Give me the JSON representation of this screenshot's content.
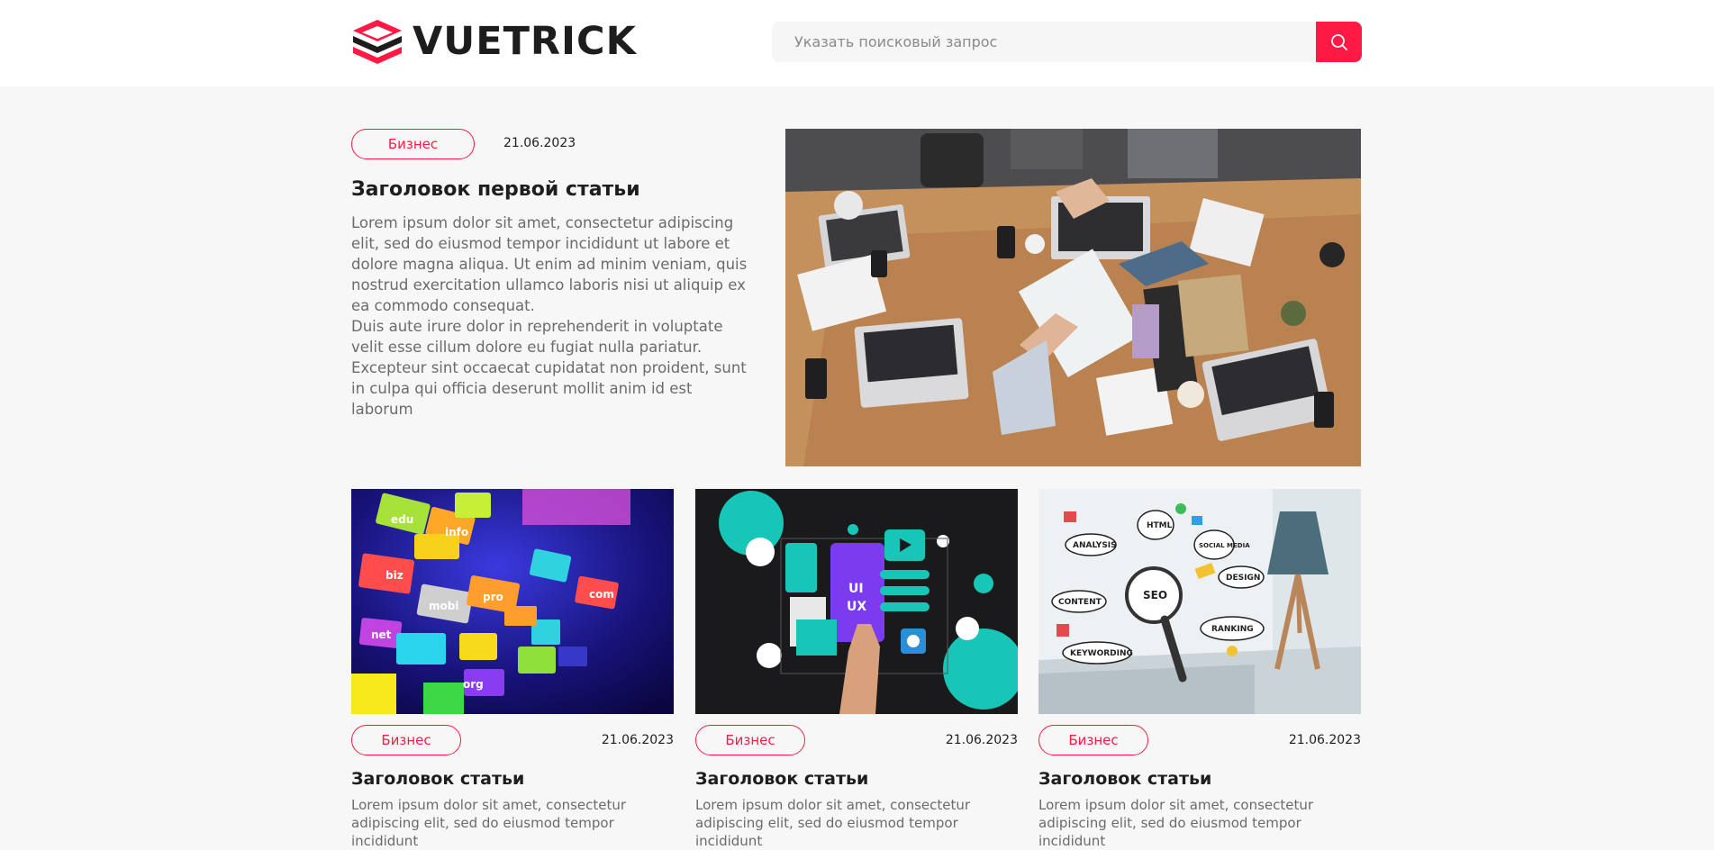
{
  "brand": {
    "name": "VUETRICK",
    "colors": {
      "accent": "#ff1945",
      "dark": "#1d1d1d"
    }
  },
  "search": {
    "placeholder": "Указать поисковый запрос",
    "value": "",
    "icon": "search-icon"
  },
  "featured": {
    "tag": "Бизнес",
    "date": "21.06.2023",
    "title": "Заголовок первой статьи",
    "body_p1": "Lorem ipsum dolor sit amet, consectetur adipiscing elit, sed do eiusmod tempor incididunt ut labore et dolore magna aliqua. Ut enim ad minim veniam, quis nostrud exercitation ullamco laboris nisi ut aliquip ex ea commodo consequat.",
    "body_p2": "Duis aute irure dolor in reprehenderit in voluptate velit esse cillum dolore eu fugiat nulla pariatur. Excepteur sint occaecat cupidatat non proident, sunt in culpa qui officia deserunt mollit anim id est laborum"
  },
  "cards": [
    {
      "tag": "Бизнес",
      "date": "21.06.2023",
      "title": "Заголовок статьи",
      "excerpt": "Lorem ipsum dolor sit amet, consectetur adipiscing elit, sed do eiusmod tempor incididunt"
    },
    {
      "tag": "Бизнес",
      "date": "21.06.2023",
      "title": "Заголовок статьи",
      "excerpt": "Lorem ipsum dolor sit amet, consectetur adipiscing elit, sed do eiusmod tempor incididunt"
    },
    {
      "tag": "Бизнес",
      "date": "21.06.2023",
      "title": "Заголовок статьи",
      "excerpt": "Lorem ipsum dolor sit amet, consectetur adipiscing elit, sed do eiusmod tempor incididunt"
    }
  ],
  "image_labels": {
    "domains": [
      "edu",
      "info",
      "biz",
      "mobi",
      "pro",
      "com",
      "net",
      "org"
    ],
    "uiux": [
      "UI",
      "UX"
    ],
    "seo": [
      "ANALYSIS",
      "HTML",
      "SOCIAL MEDIA",
      "SEO",
      "DESIGN",
      "CONTENT",
      "RANKING",
      "KEYWORDING"
    ]
  }
}
